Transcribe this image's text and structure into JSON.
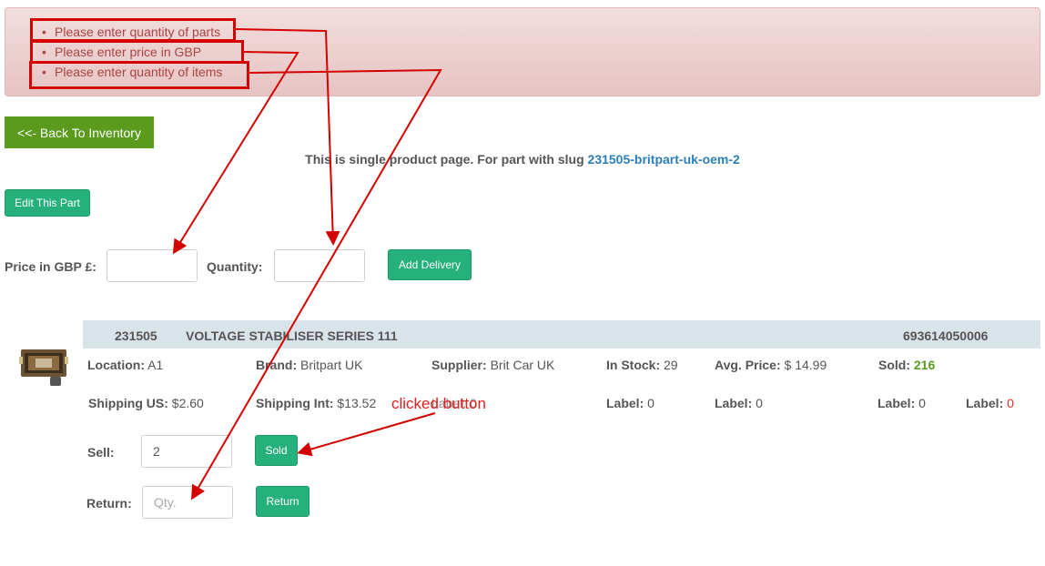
{
  "errors": [
    "Please enter quantity of parts",
    "Please enter price in GBP",
    "Please enter quantity of items"
  ],
  "nav": {
    "back_label": "<<- Back To Inventory"
  },
  "intro": {
    "text": "This is single product page. For part with slug",
    "slug": "231505-britpart-uk-oem-2"
  },
  "edit_button": "Edit This Part",
  "delivery": {
    "price_label": "Price in GBP £:",
    "price_value": "",
    "quantity_label": "Quantity:",
    "quantity_value": "",
    "add_button": "Add Delivery"
  },
  "product": {
    "part_number": "231505",
    "name": "VOLTAGE STABILISER SERIES 111",
    "barcode": "693614050006",
    "thumbnail_icon": "voltage-stabiliser-photo",
    "row1": [
      {
        "key": "Location:",
        "value": "A1"
      },
      {
        "key": "Brand:",
        "value": "Britpart UK"
      },
      {
        "key": "Supplier:",
        "value": "Brit Car UK"
      },
      {
        "key": "In Stock:",
        "value": "29"
      },
      {
        "key": "Avg. Price:",
        "value": "$ 14.99"
      },
      {
        "key": "Sold:",
        "value": "216"
      }
    ],
    "row2": [
      {
        "key": "Shipping US:",
        "value": "$2.60"
      },
      {
        "key": "Shipping Int:",
        "value": "$13.52"
      },
      {
        "key": "Label:",
        "value": "0"
      },
      {
        "key": "Label:",
        "value": "0"
      },
      {
        "key": "Label:",
        "value": "0"
      },
      {
        "key": "Label:",
        "value": "0"
      },
      {
        "key": "Label:",
        "value": "0"
      }
    ],
    "sell_label": "Sell:",
    "sell_value": "2",
    "sold_button": "Sold",
    "return_label": "Return:",
    "return_placeholder": "Qty.",
    "return_button": "Return"
  },
  "annotation": {
    "text": "clicked button"
  },
  "colors": {
    "alert_bg": "#f2dede",
    "error_text": "#a94442",
    "back_button": "#5a9b1e",
    "action_button": "#26b17c",
    "slug_link": "#2a7fb5",
    "annotation": "#d40000"
  }
}
